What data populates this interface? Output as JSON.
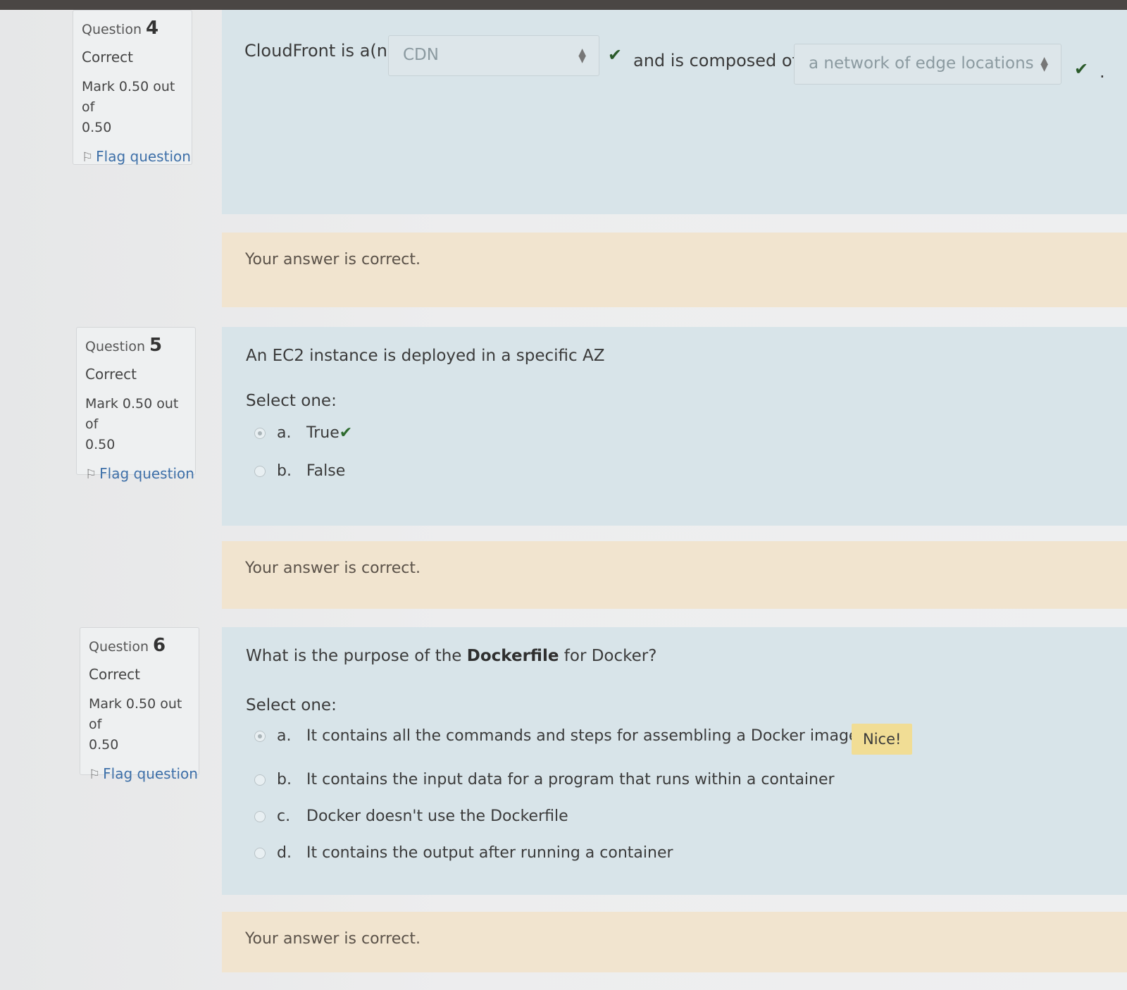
{
  "questions": [
    {
      "label": "Question",
      "number": "4",
      "state": "Correct",
      "grade_line1": "Mark 0.50 out of",
      "grade_line2": "0.50",
      "flag": "Flag question",
      "text_before": "CloudFront is a(n)",
      "select1_value": "CDN",
      "text_middle": "and is composed of",
      "select2_value": "a network of edge locations",
      "text_end": ".",
      "feedback": "Your answer is correct."
    },
    {
      "label": "Question",
      "number": "5",
      "state": "Correct",
      "grade_line1": "Mark 0.50 out of",
      "grade_line2": "0.50",
      "flag": "Flag question",
      "text": "An EC2 instance is deployed in a specific AZ",
      "prompt": "Select one:",
      "answers": [
        {
          "letter": "a.",
          "text": "True",
          "selected": true
        },
        {
          "letter": "b.",
          "text": "False",
          "selected": false
        }
      ],
      "feedback": "Your answer is correct."
    },
    {
      "label": "Question",
      "number": "6",
      "state": "Correct",
      "grade_line1": "Mark 0.50 out of",
      "grade_line2": "0.50",
      "flag": "Flag question",
      "text_pre": "What is the purpose of the ",
      "text_bold": "Dockerfile",
      "text_post": " for Docker?",
      "prompt": "Select one:",
      "answers": [
        {
          "letter": "a.",
          "text": "It contains all the commands and steps for assembling a Docker image",
          "selected": true
        },
        {
          "letter": "b.",
          "text": "It contains the input data for a program that runs within a container",
          "selected": false
        },
        {
          "letter": "c.",
          "text": "Docker doesn't use the Dockerfile",
          "selected": false
        },
        {
          "letter": "d.",
          "text": "It contains the output after running a container",
          "selected": false
        }
      ],
      "specific_feedback": "Nice!",
      "feedback": "Your answer is correct."
    }
  ],
  "icons": {
    "flag": "flag-icon",
    "check": "check-icon",
    "select_arrows": "select-arrows-icon"
  },
  "colors": {
    "correct_check": "#2a5a2a",
    "link": "#3d6fa8",
    "formulation_bg": "#d8e4e9",
    "feedback_bg": "#f1e4cf",
    "specific_feedback_bg": "#f1dd95"
  }
}
